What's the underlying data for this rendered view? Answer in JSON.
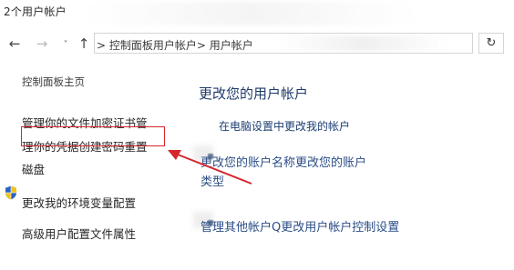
{
  "window": {
    "title": "2个用户帐户"
  },
  "nav": {
    "back_icon": "←",
    "forward_icon": "→",
    "recent_icon": "˅",
    "up_icon": "↑",
    "address": "> 控制面板用户帐户> 用户帐户",
    "dropdown_icon": "˅",
    "refresh_icon": "↻"
  },
  "left_pane": {
    "home": "控制面板主页",
    "links": {
      "encryption": "管理你的文件加密证书管",
      "credentials": "理你的凭据创建密码重置",
      "disk": "磁盘",
      "env": "更改我的环境变量配置",
      "profile": "高级用户配置文件属性"
    }
  },
  "main": {
    "heading": "更改您的用户帐户",
    "pc_settings": "在电脑设置中更改我的帐户",
    "rename": "更改您的账户名称更改您的账户类型",
    "manage": "管理其他帐户Q更改用户帐户控制设置"
  },
  "colors": {
    "highlight": "#d4262c",
    "heading": "#1f3a6a",
    "link": "#2b4d87"
  },
  "icons": {
    "shield": "uac-shield-icon",
    "arrow": "red-annotation-arrow"
  }
}
